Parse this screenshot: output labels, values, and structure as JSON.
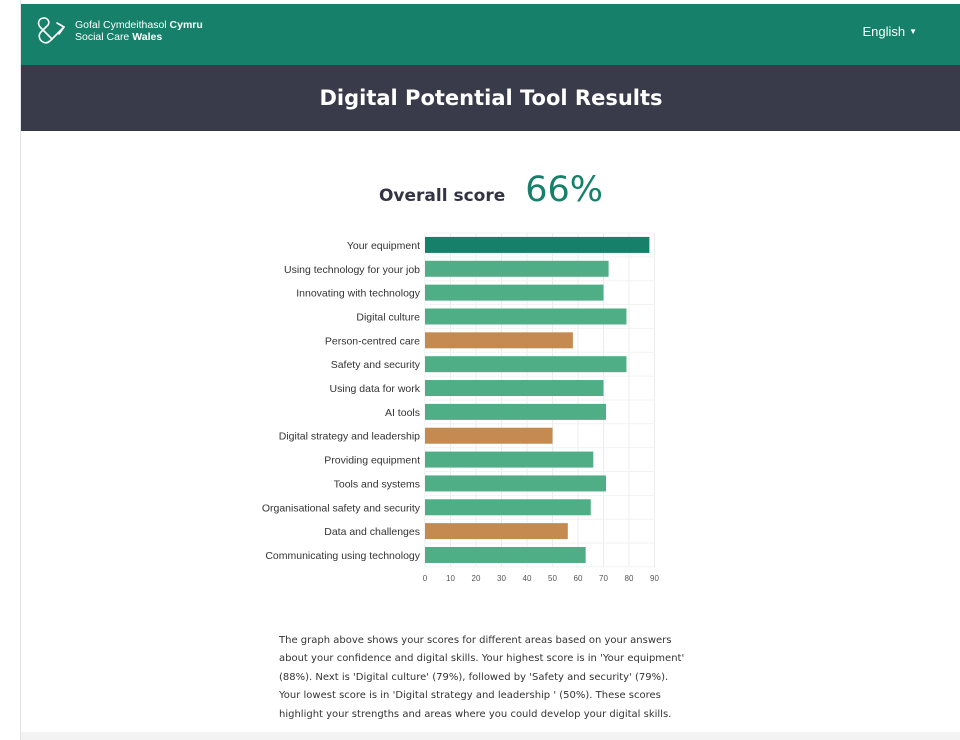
{
  "header": {
    "logo_line1_regular": "Gofal Cymdeithasol ",
    "logo_line1_bold": "Cymru",
    "logo_line2_regular": "Social Care ",
    "logo_line2_bold": "Wales",
    "language": "English",
    "brand_color": "#17806a"
  },
  "title": "Digital Potential Tool Results",
  "overall": {
    "label": "Overall score",
    "value": "66%"
  },
  "colors": {
    "highest": "#17806a",
    "normal": "#4fae86",
    "lowest": "#c48a4f"
  },
  "chart_data": {
    "type": "bar",
    "orientation": "horizontal",
    "categories": [
      "Your equipment",
      "Using technology for your job",
      "Innovating with technology",
      "Digital culture",
      "Person-centred care",
      "Safety and security",
      "Using data for work",
      "AI tools",
      "Digital strategy and leadership",
      "Providing equipment",
      "Tools and systems",
      "Organisational safety and security",
      "Data and challenges",
      "Communicating using technology"
    ],
    "values": [
      88,
      72,
      70,
      79,
      58,
      79,
      70,
      71,
      50,
      66,
      71,
      65,
      56,
      63
    ],
    "highlight": [
      "highest",
      "normal",
      "normal",
      "normal",
      "lowest",
      "normal",
      "normal",
      "normal",
      "lowest",
      "normal",
      "normal",
      "normal",
      "lowest",
      "normal"
    ],
    "xlim": [
      0,
      90
    ],
    "xticks": [
      0,
      10,
      20,
      30,
      40,
      50,
      60,
      70,
      80,
      90
    ],
    "grid": true
  },
  "summary": "The graph above shows your scores for different areas based on your answers about your confidence and digital skills. Your highest score is in 'Your equipment' (88%). Next is 'Digital culture' (79%), followed by 'Safety and security' (79%). Your lowest score is in 'Digital strategy and leadership ' (50%). These scores highlight your strengths and areas where you could develop your digital skills."
}
